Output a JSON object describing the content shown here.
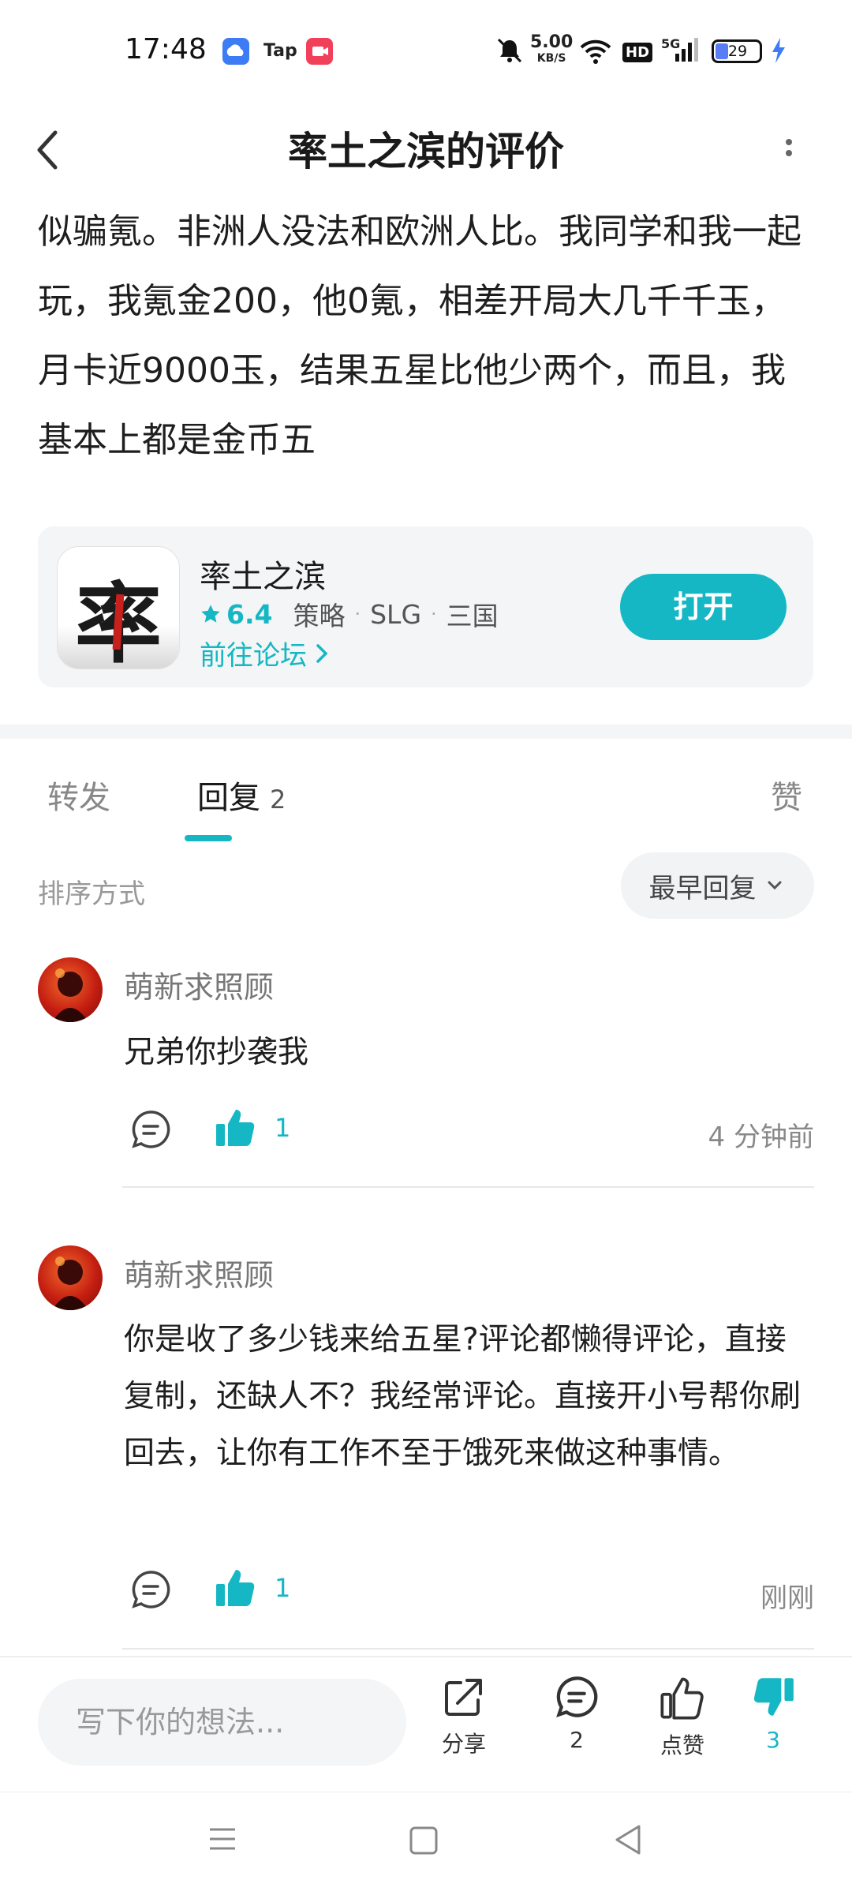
{
  "status_bar": {
    "time": "17:48",
    "app_icons": [
      "cloud-icon",
      "tap-icon",
      "record-icon"
    ],
    "net_speed_value": "5.00",
    "net_speed_unit": "KB/S",
    "hd_badge": "HD",
    "signal_label": "5G",
    "battery": "29"
  },
  "header": {
    "title": "率土之滨的评价"
  },
  "review": {
    "text": "似骗氪。非洲人没法和欧洲人比。我同学和我一起玩，我氪金200，他0氪，相差开局大几千千玉，月卡近9000玉，结果五星比他少两个，而且，我基本上都是金币五"
  },
  "app_card": {
    "icon_char": "率",
    "name": "率土之滨",
    "rating": "6.4",
    "tags": [
      "策略",
      "SLG",
      "三国"
    ],
    "forum_link": "前往论坛",
    "open_button": "打开"
  },
  "tabs": {
    "repost": "转发",
    "reply": "回复",
    "reply_count": "2",
    "like": "赞"
  },
  "sort": {
    "label": "排序方式",
    "selected": "最早回复"
  },
  "comments": [
    {
      "user": "萌新求照顾",
      "text": "兄弟你抄袭我",
      "likes": "1",
      "time": "4 分钟前"
    },
    {
      "user": "萌新求照顾",
      "text": "你是收了多少钱来给五星?评论都懒得评论，直接复制，还缺人不？我经常评论。直接开小号帮你刷回去，让你有工作不至于饿死来做这种事情。",
      "likes": "1",
      "time": "刚刚"
    }
  ],
  "bottom_bar": {
    "input_placeholder": "写下你的想法...",
    "share": "分享",
    "comment_count": "2",
    "like": "点赞",
    "dislike_count": "3"
  },
  "colors": {
    "accent": "#15b7c4",
    "avatar_red": "#c51e12"
  }
}
